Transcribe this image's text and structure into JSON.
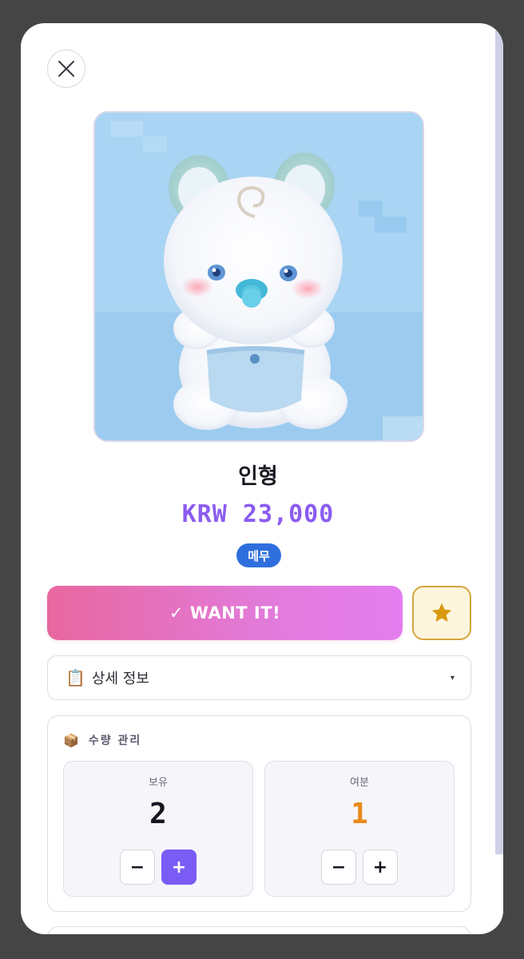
{
  "modal": {
    "close_icon": "close-icon",
    "product": {
      "title": "인형",
      "price": "KRW 23,000",
      "tag": "메무"
    },
    "actions": {
      "want_label": "✓ WANT IT!",
      "favorite_icon": "star-icon"
    },
    "details": {
      "icon": "📋",
      "label": "상세 정보",
      "caret": "▾"
    },
    "quantity": {
      "icon": "📦",
      "title": "수량 관리",
      "owned": {
        "label": "보유",
        "value": "2",
        "minus": "−",
        "plus": "+"
      },
      "spare": {
        "label": "여분",
        "value": "1",
        "minus": "−",
        "plus": "+"
      }
    }
  },
  "colors": {
    "accent": "#8b5cf0",
    "badge": "#2f6fdd",
    "want_gradient_start": "#e8679f",
    "want_gradient_end": "#e47ef0",
    "star": "#d99a12",
    "spare_value": "#e88a1a",
    "plus_primary": "#7a5cf5"
  }
}
